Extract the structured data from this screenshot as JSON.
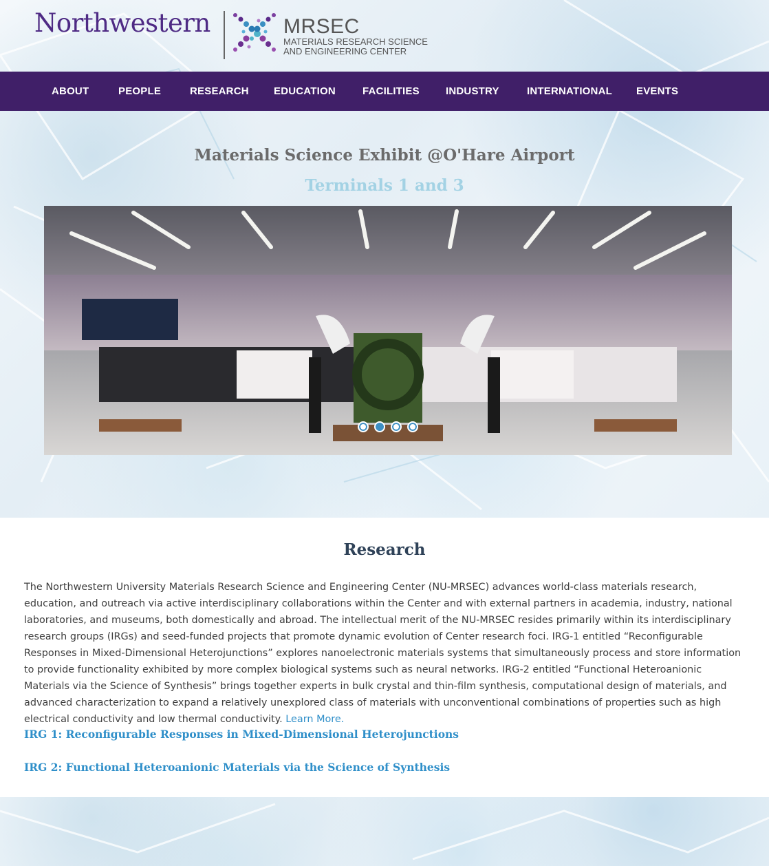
{
  "header": {
    "university": "Northwestern",
    "center_acronym": "MRSEC",
    "center_line1": "MATERIALS RESEARCH SCIENCE",
    "center_line2": "AND ENGINEERING CENTER"
  },
  "nav": {
    "items": [
      "ABOUT",
      "PEOPLE",
      "RESEARCH",
      "EDUCATION",
      "FACILITIES",
      "INDUSTRY",
      "INTERNATIONAL",
      "EVENTS"
    ]
  },
  "hero": {
    "title": "Materials Science Exhibit @O'Hare Airport",
    "subtitle": "Terminals 1 and 3",
    "slider": {
      "slide_count": 4,
      "active_index": 1,
      "image_description_icon": "exhibit-photo"
    }
  },
  "research": {
    "title": "Research",
    "body": "The Northwestern University Materials Research Science and Engineering Center (NU-MRSEC) advances world-class materials research, education, and outreach via active interdisciplinary collaborations within the Center and with external partners in academia, industry, national laboratories, and museums, both domestically and abroad. The intellectual merit of the NU-MRSEC resides primarily within its interdisciplinary research groups (IRGs) and seed-funded projects that promote dynamic evolution of Center research foci. IRG-1 entitled “Reconfigurable Responses in Mixed-Dimensional Heterojunctions” explores nanoelectronic materials systems that simultaneously process and store information to provide functionality exhibited by more complex biological systems such as neural networks. IRG-2 entitled “Functional Heteroanionic Materials via the Science of Synthesis” brings together experts in bulk crystal and thin-film synthesis, computational design of materials, and advanced characterization to expand a relatively unexplored class of materials with unconventional combinations of properties such as high electrical conductivity and low thermal conductivity.",
    "learn_more": "Learn More.",
    "irg1": "IRG 1: Reconfigurable Responses in Mixed-Dimensional Heterojunctions",
    "irg2": "IRG 2: Functional Heteroanionic Materials via the Science of Synthesis"
  },
  "colors": {
    "brand_purple": "#4e2a84",
    "nav_bg": "#401f68",
    "link_blue": "#2f8fc9",
    "subtitle_blue": "#a3d2e4"
  }
}
